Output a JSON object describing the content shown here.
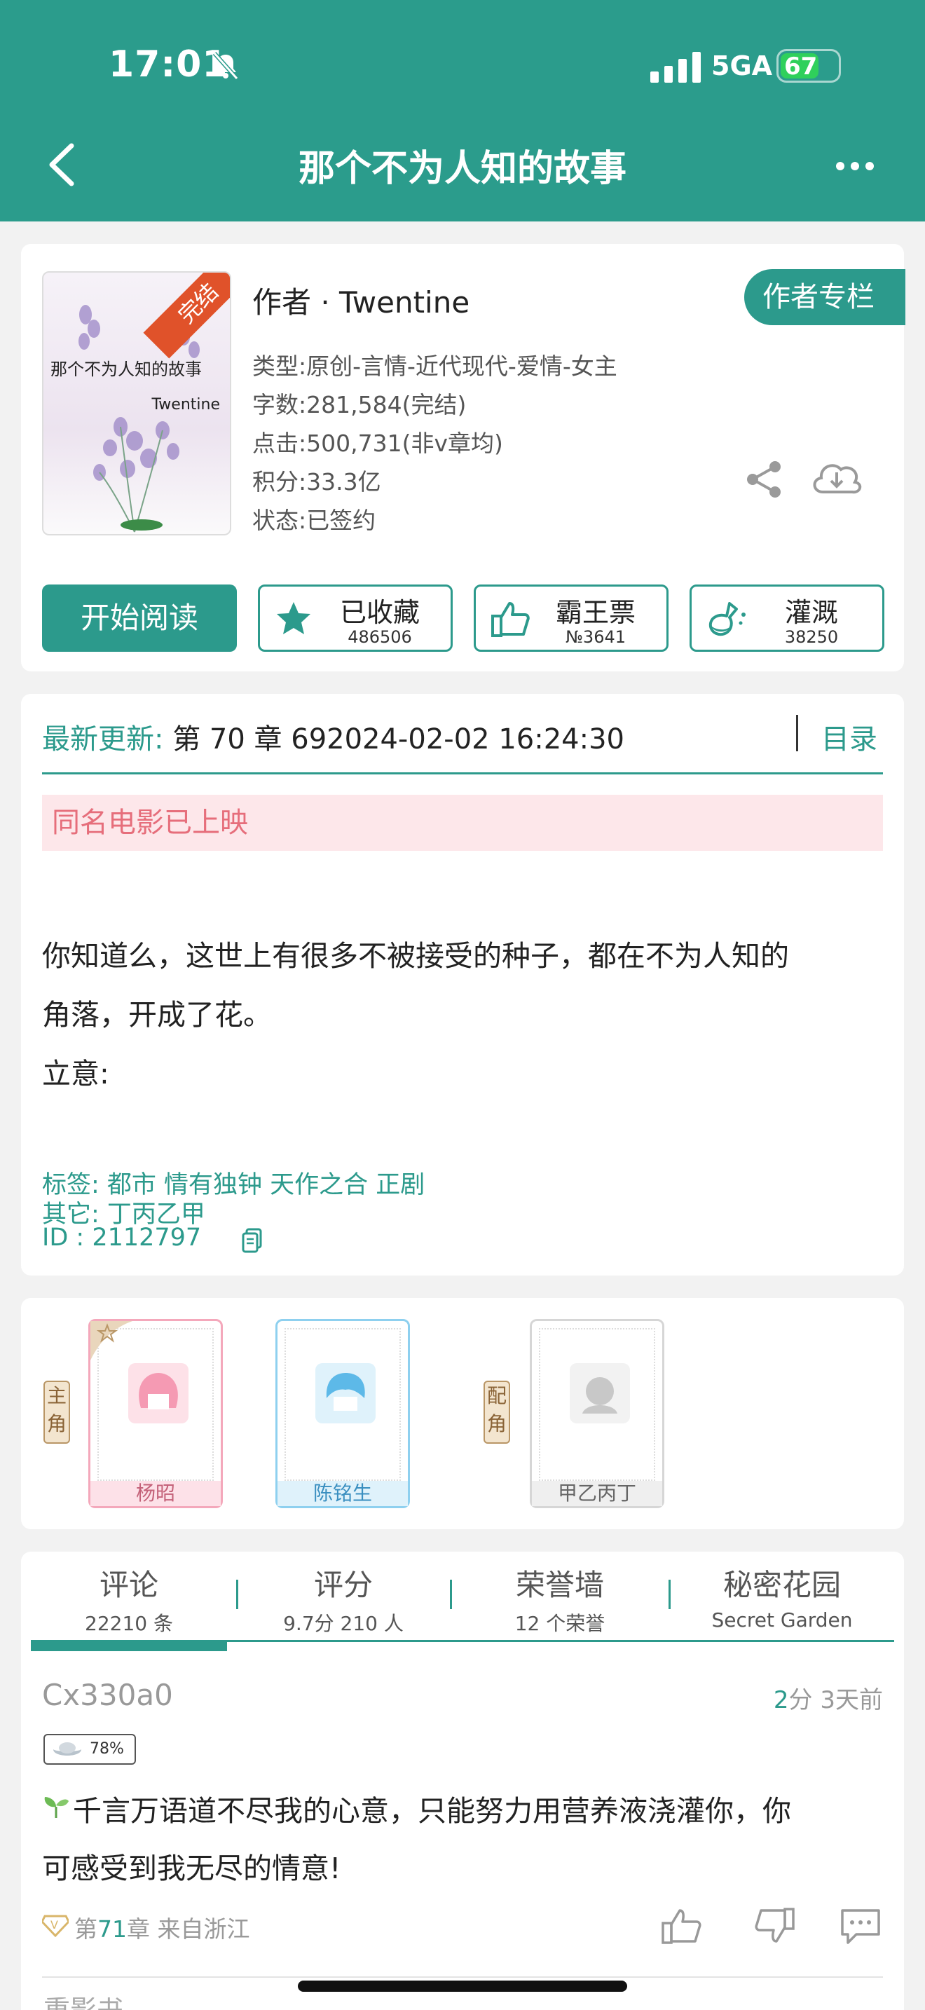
{
  "status_bar": {
    "time": "17:01",
    "network": "5GA",
    "battery": "67",
    "battery_level": 0.67
  },
  "nav": {
    "title": "那个不为人知的故事"
  },
  "book": {
    "cover_title": "那个不为人知的故事",
    "cover_author": "Twentine",
    "cover_ribbon": "完结",
    "author": "作者 · Twentine",
    "author_column": "作者专栏",
    "genre": "类型:原创-言情-近代现代-爱情-女主",
    "words": "字数:281,584(完结)",
    "clicks": "点击:500,731(非v章均)",
    "score": "积分:33.3亿",
    "status": "状态:已签约"
  },
  "actions": {
    "read": "开始阅读",
    "favorite_label": "已收藏",
    "favorite_count": "486506",
    "vote_label": "霸王票",
    "vote_count": "№3641",
    "water_label": "灌溉",
    "water_count": "38250"
  },
  "info": {
    "update_label": "最新更新:",
    "update_text": " 第 70 章 692024-02-02 16:24:30",
    "toc": "目录",
    "notice": "同名电影已上映",
    "intro_lines": [
      "你知道么，这世上有很多不被接受的种子，都在不为人知的",
      "角落，开成了花。",
      "立意:"
    ],
    "tags": "标签: 都市  情有独钟  天作之合  正剧",
    "other": "其它: 丁丙乙甲",
    "id": "ID   :  2112797"
  },
  "roles": {
    "main_badge": "主角",
    "support_badge": "配角",
    "characters": [
      {
        "name": "杨昭",
        "color": "#f48aa6"
      },
      {
        "name": "陈铭生",
        "color": "#4fb3e4"
      },
      {
        "name": "甲乙丙丁",
        "color": "#aaaaaa"
      }
    ]
  },
  "tabs": [
    {
      "label": "评论",
      "count": "22210 条"
    },
    {
      "label": "评分",
      "count": "9.7分 210 人"
    },
    {
      "label": "荣誉墙",
      "count": "12 个荣誉"
    },
    {
      "label": "秘密花园",
      "count": "Secret Garden"
    }
  ],
  "comment": {
    "user": "Cx330a0",
    "score": "2",
    "score_unit": "分",
    "time": "3天前",
    "level": "78%",
    "lines": [
      "千言万语道不尽我的心意，只能努力用营养液浇灌你，你",
      "可感受到我无尽的情意!"
    ],
    "chapter_prefix": "第",
    "chapter": "71",
    "chapter_suffix": "章 来自浙江"
  },
  "next_comment_partial": "重影书",
  "colors": {
    "brand": "#2b9c8c",
    "notice_bg": "#fde7ea",
    "notice_text": "#e66e7b",
    "ribbon": "#e0522a"
  }
}
